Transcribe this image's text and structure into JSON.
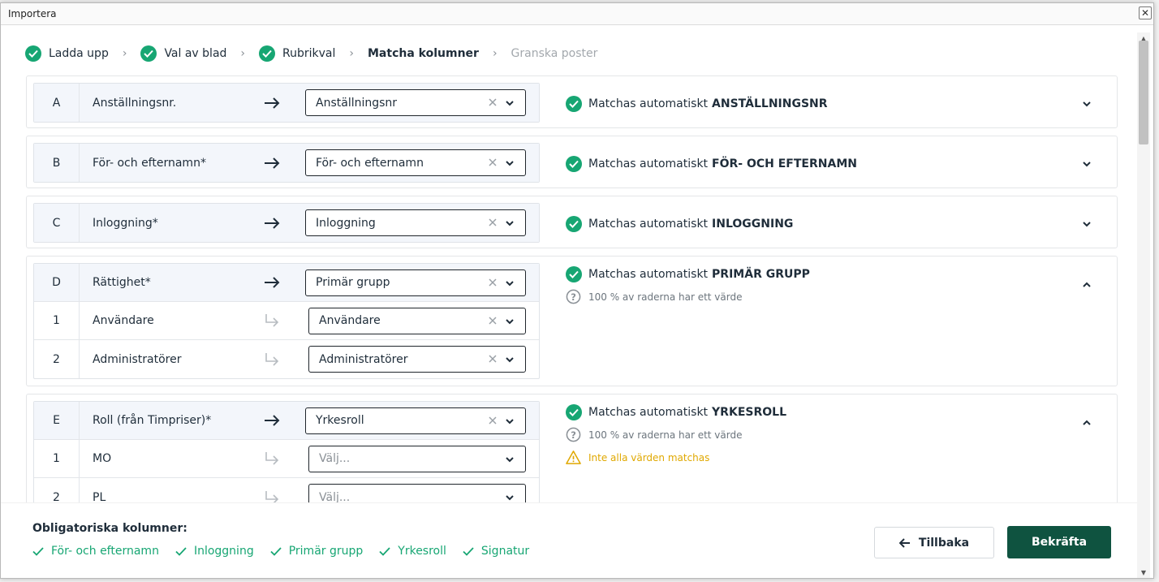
{
  "window": {
    "title": "Importera"
  },
  "steps": [
    {
      "label": "Ladda upp",
      "state": "done"
    },
    {
      "label": "Val av blad",
      "state": "done"
    },
    {
      "label": "Rubrikval",
      "state": "done"
    },
    {
      "label": "Matcha kolumner",
      "state": "active"
    },
    {
      "label": "Granska poster",
      "state": "future"
    }
  ],
  "status_prefix": "Matchas automatiskt",
  "coverage_text": "100 % av raderna har ett värde",
  "warning_text": "Inte alla värden matchas",
  "placeholder": "Välj...",
  "columns": [
    {
      "letter": "A",
      "label": "Anställningsnr.",
      "selected": "Anställningsnr",
      "matched": "ANSTÄLLNINGSNR"
    },
    {
      "letter": "B",
      "label": "För- och efternamn*",
      "selected": "För- och efternamn",
      "matched": "FÖR- OCH EFTERNAMN"
    },
    {
      "letter": "C",
      "label": "Inloggning*",
      "selected": "Inloggning",
      "matched": "INLOGGNING"
    },
    {
      "letter": "D",
      "label": "Rättighet*",
      "selected": "Primär grupp",
      "matched": "PRIMÄR GRUPP",
      "values": [
        {
          "index": "1",
          "label": "Användare",
          "selected": "Användare"
        },
        {
          "index": "2",
          "label": "Administratörer",
          "selected": "Administratörer"
        }
      ]
    },
    {
      "letter": "E",
      "label": "Roll (från Timpriser)*",
      "selected": "Yrkesroll",
      "matched": "YRKESROLL",
      "values": [
        {
          "index": "1",
          "label": "MO",
          "selected": ""
        },
        {
          "index": "2",
          "label": "PL",
          "selected": ""
        }
      ]
    }
  ],
  "footer": {
    "title": "Obligatoriska kolumner:",
    "required": [
      "För- och efternamn",
      "Inloggning",
      "Primär grupp",
      "Yrkesroll",
      "Signatur"
    ],
    "back_label": "Tillbaka",
    "confirm_label": "Bekräfta"
  },
  "colors": {
    "accent": "#17a673",
    "primary": "#0f5340",
    "warning": "#e0a800"
  },
  "icons": [
    "check-circle-icon",
    "chevron-right-icon",
    "arrow-right-icon",
    "arrow-return-icon",
    "clear-icon",
    "chevron-down-icon",
    "chevron-up-icon",
    "question-circle-icon",
    "warning-icon",
    "checkmark-icon",
    "arrow-left-icon",
    "close-icon"
  ]
}
